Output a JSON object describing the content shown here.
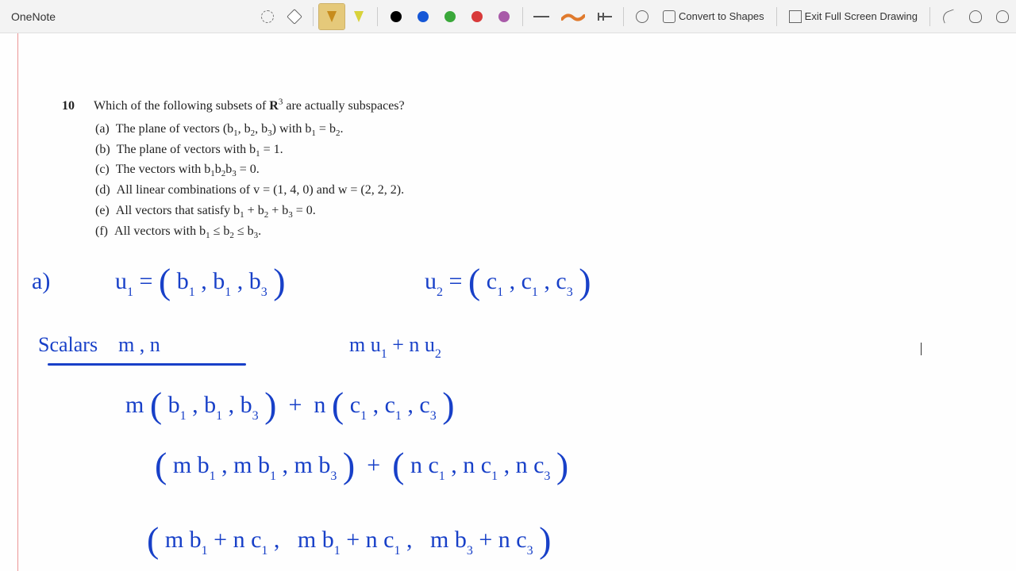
{
  "app": {
    "title": "OneNote"
  },
  "toolbar": {
    "highlighter1_color": "#c78c1c",
    "highlighter2_color": "#d8d23a",
    "ink_colors": [
      "#000000",
      "#1557d6",
      "#3aa83a",
      "#d83a3a",
      "#a85aa8"
    ],
    "stroke_wave_color": "#e07a2d",
    "convert_label": "Convert to Shapes",
    "exit_label": "Exit Full Screen Drawing"
  },
  "problem": {
    "number": "10",
    "question_prefix": "Which of the following subsets of ",
    "question_space": "R",
    "question_space_exp": "3",
    "question_suffix": " are actually subspaces?",
    "items": [
      {
        "tag": "(a)",
        "html": "The plane of vectors (b<sub>1</sub>, b<sub>2</sub>, b<sub>3</sub>) with b<sub>1</sub> = b<sub>2</sub>."
      },
      {
        "tag": "(b)",
        "html": "The plane of vectors with b<sub>1</sub> = 1."
      },
      {
        "tag": "(c)",
        "html": "The vectors with b<sub>1</sub>b<sub>2</sub>b<sub>3</sub> = 0."
      },
      {
        "tag": "(d)",
        "html": "All linear combinations of v = (1, 4, 0) and w = (2, 2, 2)."
      },
      {
        "tag": "(e)",
        "html": "All vectors that satisfy b<sub>1</sub> + b<sub>2</sub> + b<sub>3</sub> = 0."
      },
      {
        "tag": "(f)",
        "html": "All vectors with b<sub>1</sub> ≤ b<sub>2</sub> ≤ b<sub>3</sub>."
      }
    ]
  },
  "handwriting": {
    "l1_a": "a)",
    "l1_u1": "u<sub>1</sub>  =  <span class=\"paren\">(</span> b<sub>1</sub> , b<sub>1</sub> , b<sub>3</sub> <span class=\"paren\">)</span>",
    "l1_u2": "u<sub>2</sub>  =  <span class=\"paren\">(</span> c<sub>1</sub> , c<sub>1</sub> , c<sub>3</sub> <span class=\"paren\">)</span>",
    "l2_scalars": "Scalars &nbsp;&nbsp; m , n",
    "l2_comb": "m u<sub>1</sub>  +  n u<sub>2</sub>",
    "l3": "m <span class=\"paren\">(</span> b<sub>1</sub> , b<sub>1</sub> , b<sub>3</sub> <span class=\"paren\">)</span>&nbsp;&nbsp;+&nbsp;&nbsp;n <span class=\"paren\">(</span> c<sub>1</sub> , c<sub>1</sub> , c<sub>3</sub> <span class=\"paren\">)</span>",
    "l4": "<span class=\"paren\">(</span> m b<sub>1</sub> , m b<sub>1</sub> , m b<sub>3</sub> <span class=\"paren\">)</span>&nbsp;&nbsp;+&nbsp;&nbsp;<span class=\"paren\">(</span> n c<sub>1</sub> , n c<sub>1</sub> , n c<sub>3</sub> <span class=\"paren\">)</span>",
    "l5": "<span class=\"paren\">(</span> m b<sub>1</sub> + n c<sub>1</sub> ,&nbsp;&nbsp; m b<sub>1</sub> + n c<sub>1</sub> ,&nbsp;&nbsp; m b<sub>3</sub> + n c<sub>3</sub> <span class=\"paren\">)</span>"
  }
}
